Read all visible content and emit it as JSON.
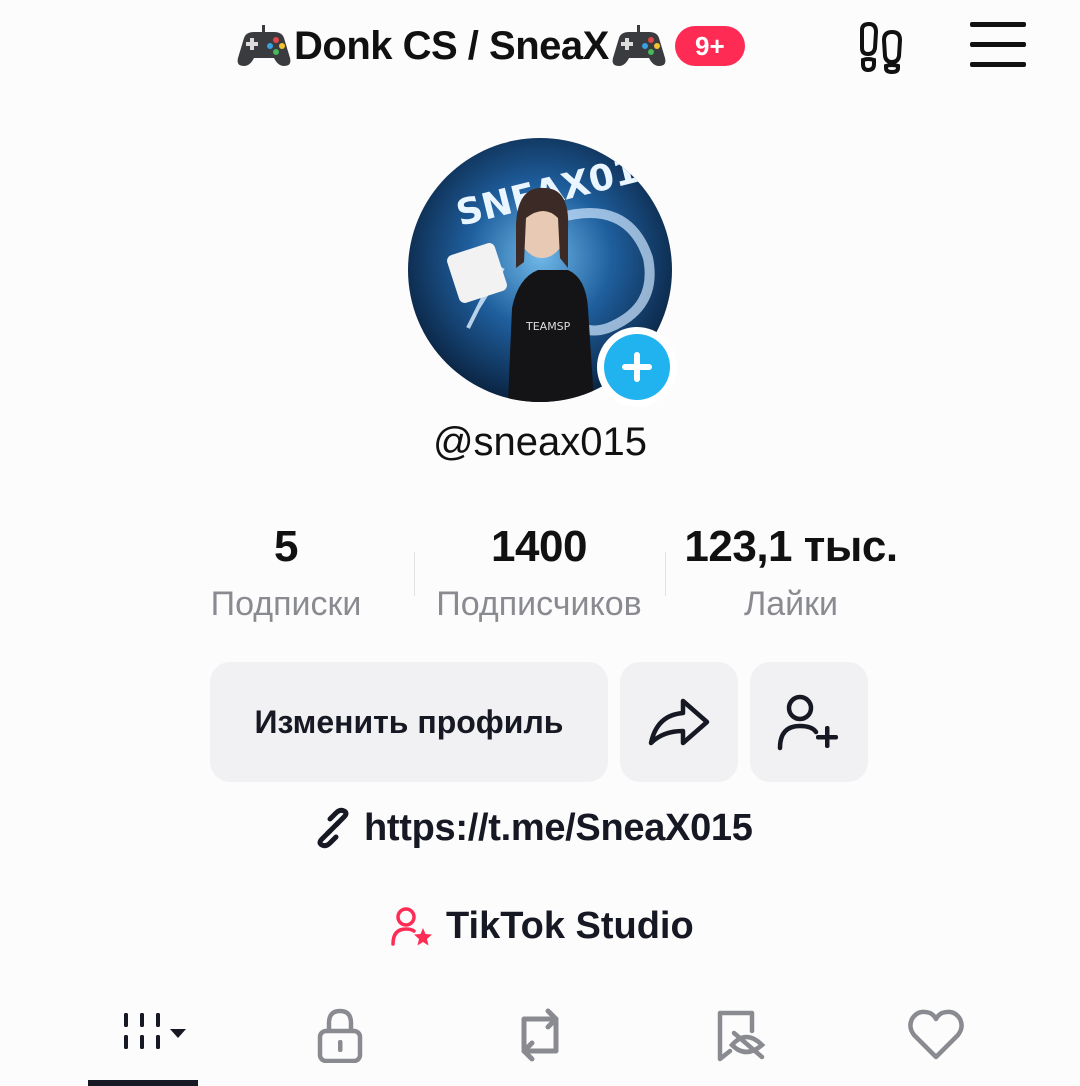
{
  "header": {
    "title": "Donk CS / SneaX",
    "notification_count": "9+",
    "left_icon": "gamepad-icon",
    "right_title_icon": "gamepad-icon",
    "footprint_icon": "footprint-icon",
    "menu_icon": "hamburger-menu-icon"
  },
  "profile": {
    "username": "@sneax015",
    "avatar_icon": "avatar-image",
    "add_avatar_icon": "plus-icon"
  },
  "stats": {
    "following": {
      "value": "5",
      "label": "Подписки"
    },
    "followers": {
      "value": "1400",
      "label": "Подписчиков"
    },
    "likes": {
      "value": "123,1 тыс.",
      "label": "Лайки"
    }
  },
  "actions": {
    "edit_profile_label": "Изменить профиль",
    "share_icon": "share-arrow-icon",
    "add_friend_icon": "add-user-icon"
  },
  "bio_link": {
    "icon": "link-icon",
    "text": "https://t.me/SneaX015"
  },
  "studio": {
    "icon": "studio-user-star-icon",
    "label": "TikTok Studio"
  },
  "tabs": [
    {
      "name": "videos-grid",
      "icon": "grid-dropdown-icon",
      "active": true
    },
    {
      "name": "private",
      "icon": "lock-icon"
    },
    {
      "name": "reposts",
      "icon": "repost-icon"
    },
    {
      "name": "favorites",
      "icon": "bookmark-eye-icon"
    },
    {
      "name": "liked",
      "icon": "heart-icon"
    }
  ],
  "colors": {
    "accent_red": "#fe2c55",
    "accent_blue": "#20b3ef",
    "text_primary": "#161823",
    "text_secondary": "#8a8b91",
    "button_bg": "#f1f0f2"
  }
}
